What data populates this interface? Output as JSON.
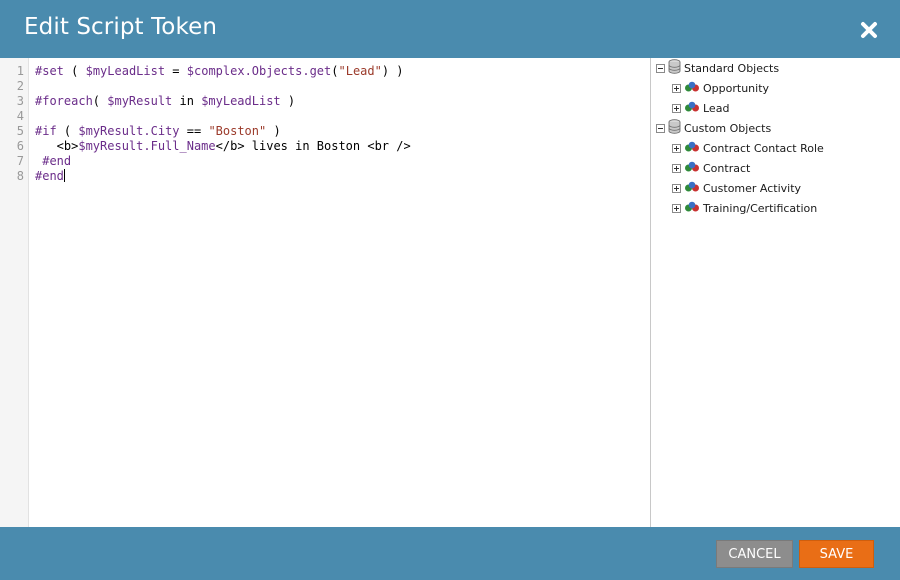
{
  "dialog": {
    "title": "Edit Script Token",
    "close_icon": "close-icon"
  },
  "editor": {
    "line_numbers": [
      "1",
      "2",
      "3",
      "4",
      "5",
      "6",
      "7",
      "8"
    ],
    "lines": [
      "#set ( $myLeadList = $complex.Objects.get(\"Lead\") )",
      "",
      "#foreach( $myResult in $myLeadList )",
      "",
      "#if ( $myResult.City == \"Boston\" )",
      "   <b>$myResult.Full_Name</b> lives in Boston <br />",
      " #end",
      "#end"
    ]
  },
  "tree": {
    "groups": [
      {
        "label": "Standard Objects",
        "children": [
          "Opportunity",
          "Lead"
        ]
      },
      {
        "label": "Custom Objects",
        "children": [
          "Contract Contact Role",
          "Contract",
          "Customer Activity",
          "Training/Certification"
        ]
      }
    ]
  },
  "footer": {
    "cancel_label": "CANCEL",
    "save_label": "SAVE"
  },
  "colors": {
    "header_bg": "#4a8bae",
    "save_bg": "#e96e16",
    "cancel_bg": "#8d8d8d",
    "keyword": "#6b2d8a",
    "string": "#9b3a2a"
  }
}
